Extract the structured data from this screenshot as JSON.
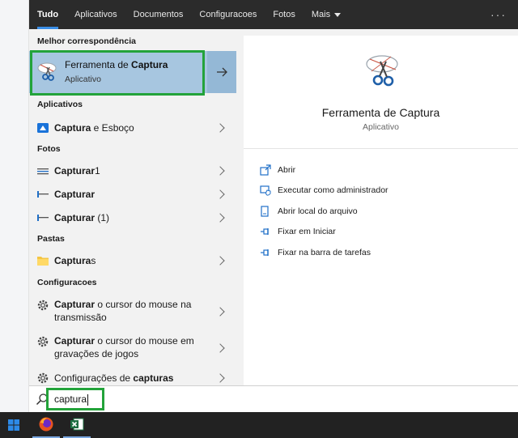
{
  "tabs": [
    {
      "label": "Tudo",
      "active": true
    },
    {
      "label": "Aplicativos"
    },
    {
      "label": "Documentos"
    },
    {
      "label": "Configuracoes"
    },
    {
      "label": "Fotos"
    },
    {
      "label": "Mais"
    }
  ],
  "more_options": "···",
  "sections": {
    "best": "Melhor correspondência",
    "apps": "Aplicativos",
    "photos": "Fotos",
    "folders": "Pastas",
    "settings": "Configuracoes"
  },
  "best_match": {
    "title_prefix": "Ferramenta de ",
    "title_bold": "Captura",
    "subtitle": "Aplicativo",
    "icon": "snipping-tool-icon"
  },
  "apps": [
    {
      "bold": "Captura",
      "rest": " e Esboço",
      "icon": "snip-sketch-icon"
    }
  ],
  "photos": [
    {
      "bold": "Capturar",
      "rest": "1",
      "icon": "image-file-icon"
    },
    {
      "bold": "Capturar",
      "rest": "",
      "icon": "image-file-icon"
    },
    {
      "bold": "Capturar",
      "rest": " (1)",
      "icon": "image-file-icon"
    }
  ],
  "folders": [
    {
      "bold": "Captura",
      "rest": "s",
      "icon": "folder-icon"
    }
  ],
  "settings": [
    {
      "bold": "Capturar",
      "rest": " o cursor do mouse na",
      "line2": "transmissão",
      "icon": "gear-icon"
    },
    {
      "bold": "Capturar",
      "rest": " o cursor do mouse em",
      "line2": "gravações de jogos",
      "icon": "gear-icon"
    },
    {
      "pre": "Configurações de ",
      "bold": "capturas",
      "icon": "gear-icon"
    }
  ],
  "preview": {
    "title": "Ferramenta de Captura",
    "subtitle": "Aplicativo",
    "actions": [
      {
        "label": "Abrir",
        "icon": "open-icon"
      },
      {
        "label": "Executar como administrador",
        "icon": "admin-shield-icon"
      },
      {
        "label": "Abrir local do arquivo",
        "icon": "file-location-icon"
      },
      {
        "label": "Fixar em Iniciar",
        "icon": "pin-icon"
      },
      {
        "label": "Fixar na barra de tarefas",
        "icon": "pin-icon"
      }
    ]
  },
  "search": {
    "value": "captura"
  },
  "taskbar": {
    "apps": [
      "windows-start-icon",
      "firefox-icon",
      "excel-icon"
    ]
  },
  "colors": {
    "accent": "#3a8ee6",
    "highlight": "#a7c6e0",
    "annotation": "#23a33a",
    "taskbar": "#222222"
  }
}
